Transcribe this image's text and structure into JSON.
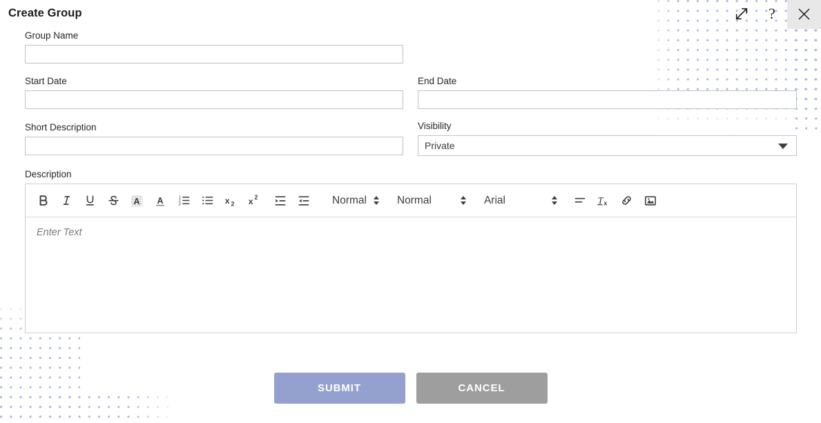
{
  "dialog": {
    "title": "Create Group"
  },
  "window_controls": {
    "expand": {
      "name": "expand-icon",
      "title": "Expand"
    },
    "help": {
      "name": "help-icon",
      "title": "Help",
      "glyph": "?"
    },
    "close": {
      "name": "close-icon",
      "title": "Close"
    }
  },
  "form": {
    "group_name": {
      "label": "Group Name",
      "value": "",
      "placeholder": ""
    },
    "start_date": {
      "label": "Start Date",
      "value": "",
      "placeholder": ""
    },
    "end_date": {
      "label": "End Date",
      "value": "",
      "placeholder": ""
    },
    "short_description": {
      "label": "Short Description",
      "value": "",
      "placeholder": ""
    },
    "visibility": {
      "label": "Visibility",
      "selected": "Private",
      "options": [
        "Private"
      ]
    },
    "description": {
      "label": "Description",
      "placeholder": "Enter Text",
      "toolbar": {
        "buttons": [
          {
            "name": "bold-icon",
            "label": "Bold"
          },
          {
            "name": "italic-icon",
            "label": "Italic"
          },
          {
            "name": "underline-icon",
            "label": "Underline"
          },
          {
            "name": "strikethrough-icon",
            "label": "Strikethrough"
          },
          {
            "name": "highlight-color-icon",
            "label": "Highlight Color"
          },
          {
            "name": "font-color-icon",
            "label": "Font Color"
          },
          {
            "name": "ordered-list-icon",
            "label": "Ordered List"
          },
          {
            "name": "unordered-list-icon",
            "label": "Unordered List"
          },
          {
            "name": "subscript-icon",
            "label": "Subscript"
          },
          {
            "name": "superscript-icon",
            "label": "Superscript"
          },
          {
            "name": "outdent-icon",
            "label": "Decrease Indent"
          },
          {
            "name": "indent-icon",
            "label": "Increase Indent"
          }
        ],
        "selects": [
          {
            "name": "paragraph-style-select",
            "value": "Normal"
          },
          {
            "name": "font-size-select",
            "value": "Normal"
          },
          {
            "name": "font-family-select",
            "value": "Arial"
          }
        ],
        "trailing_buttons": [
          {
            "name": "align-icon",
            "label": "Align"
          },
          {
            "name": "clear-formatting-icon",
            "label": "Clear Formatting"
          },
          {
            "name": "link-icon",
            "label": "Insert Link"
          },
          {
            "name": "image-icon",
            "label": "Insert Image"
          }
        ]
      }
    }
  },
  "actions": {
    "submit": "SUBMIT",
    "cancel": "CANCEL"
  },
  "colors": {
    "submit_bg": "#94a1cf",
    "cancel_bg": "#9e9e9e",
    "dot_pattern": "#a9b4e2",
    "input_border": "#b9c2cc"
  }
}
